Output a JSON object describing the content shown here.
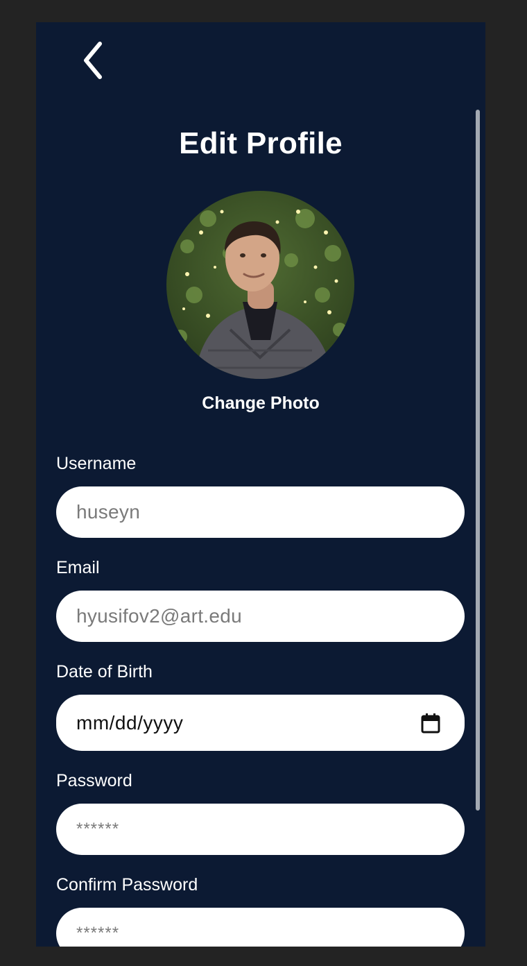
{
  "header": {
    "back_icon": "chevron-left-icon",
    "title": "Edit Profile"
  },
  "profile": {
    "avatar": "profile-photo",
    "change_photo_label": "Change Photo"
  },
  "form": {
    "username": {
      "label": "Username",
      "placeholder": "huseyn"
    },
    "email": {
      "label": "Email",
      "placeholder": "hyusifov2@art.edu"
    },
    "dob": {
      "label": "Date of Birth",
      "value": "mm/dd/yyyy",
      "icon": "calendar-icon"
    },
    "password": {
      "label": "Password",
      "placeholder": "******"
    },
    "confirm_password": {
      "label": "Confirm Password",
      "placeholder": "******"
    }
  },
  "colors": {
    "page_background": "#232323",
    "screen_background": "#0c1a33",
    "field_background": "#ffffff",
    "placeholder_text": "#7a7a7a",
    "scrollbar": "#a3a9b2"
  }
}
